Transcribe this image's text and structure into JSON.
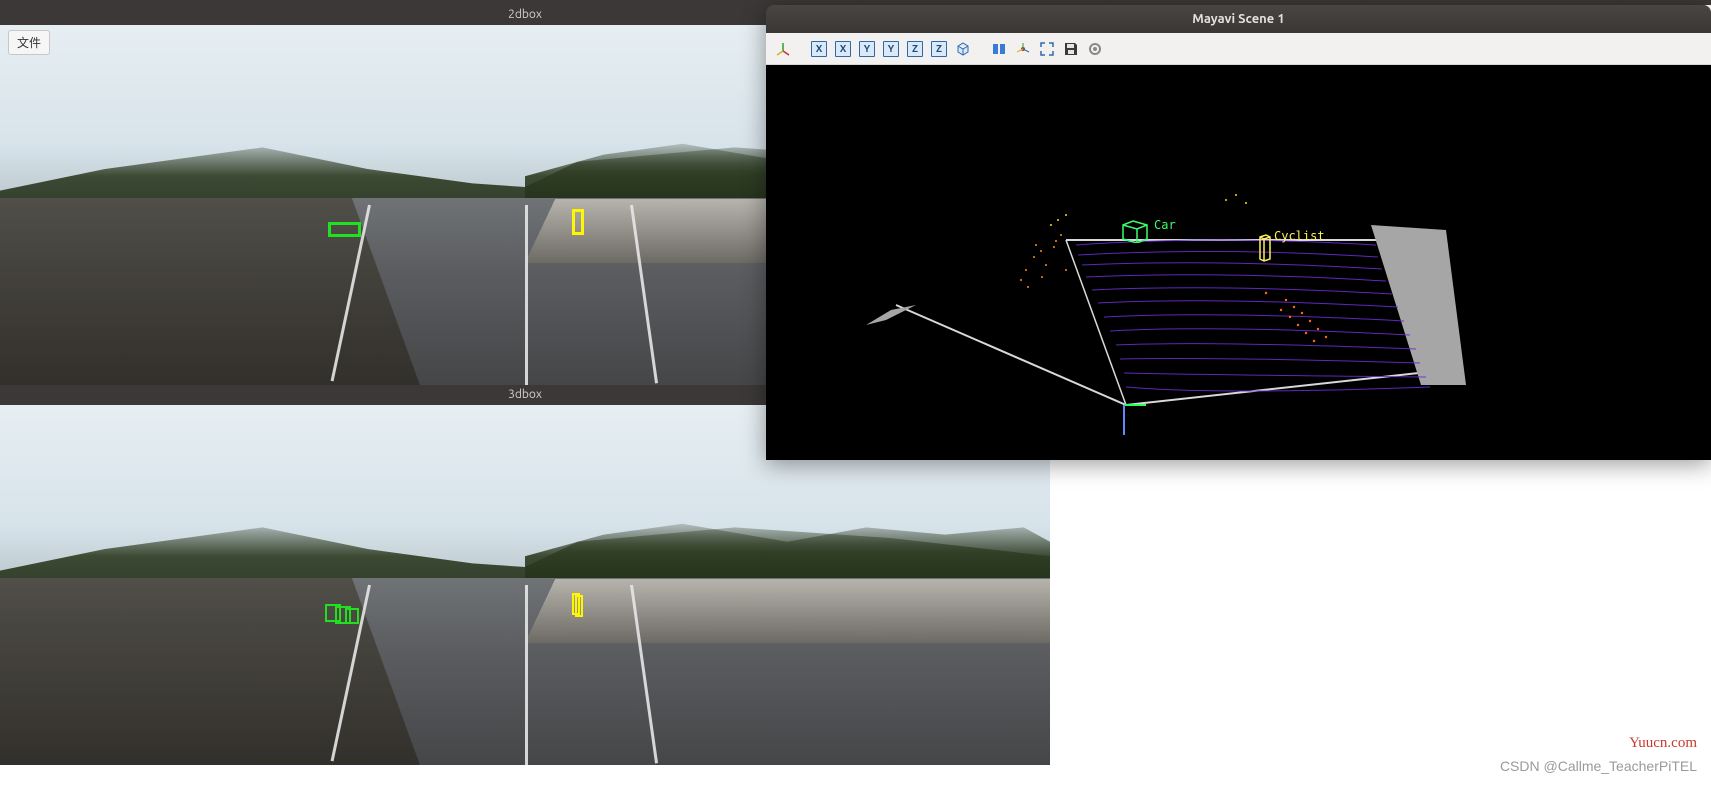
{
  "topbar": {},
  "windows": {
    "box2d": {
      "title": "2dbox"
    },
    "box3d": {
      "title": "3dbox"
    }
  },
  "file_menu": {
    "label": "文件"
  },
  "mayavi": {
    "title": "Mayavi Scene 1",
    "toolbar": {
      "view3d": "3D",
      "x_plus": "X",
      "x_minus": "X",
      "y_plus": "Y",
      "y_minus": "Y",
      "z_plus": "Z",
      "z_minus": "Z",
      "iso": "iso",
      "parallel": "parallel",
      "axes": "axes",
      "fullscreen": "fullscreen",
      "save": "save",
      "settings": "settings"
    },
    "labels": {
      "car": "Car",
      "cyclist": "Cyclist"
    }
  },
  "detections_2d": {
    "car": {
      "class": "Car",
      "color": "#20e020"
    },
    "cyclist": {
      "class": "Cyclist",
      "color": "#fff700"
    }
  },
  "detections_3d": {
    "car": {
      "class": "Car",
      "color": "#20e020"
    },
    "cyclist": {
      "class": "Cyclist",
      "color": "#fff700"
    }
  },
  "watermarks": {
    "yuucn": "Yuucn.com",
    "csdn": "CSDN @Callme_TeacherPiTEL"
  }
}
